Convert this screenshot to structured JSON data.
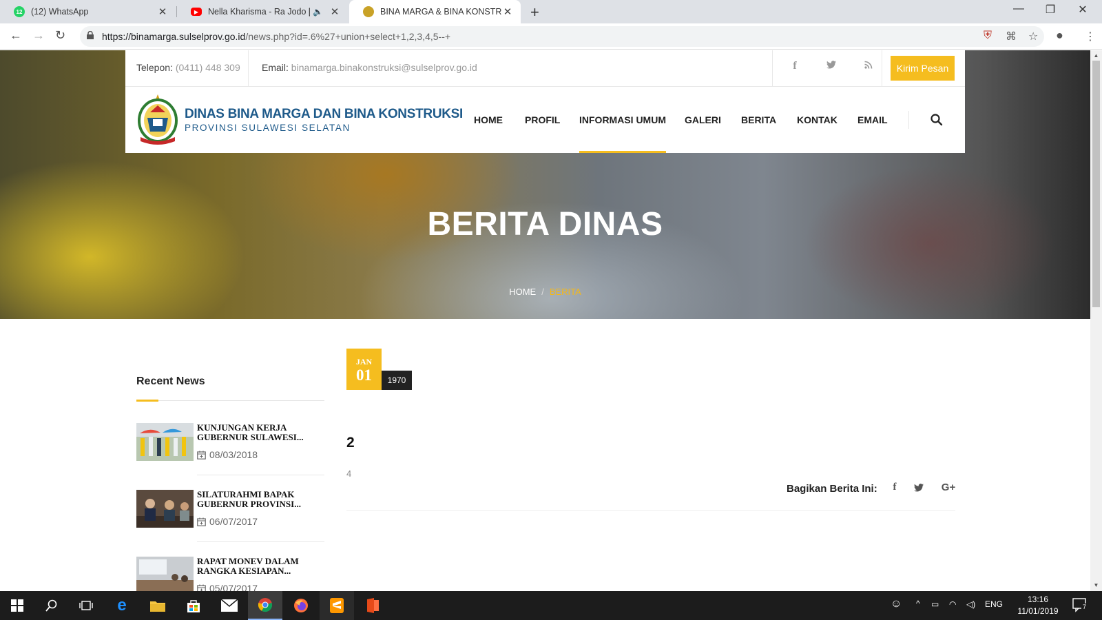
{
  "browser": {
    "tabs": [
      {
        "title": "(12) WhatsApp",
        "badge": "12"
      },
      {
        "title": "Nella Kharisma - Ra Jodo [Of"
      },
      {
        "title": "BINA MARGA & BINA KONSTRU"
      }
    ],
    "url_domain": "https://binamarga.sulselprov.go.id",
    "url_path": "/news.php?id=.6%27+union+select+1,2,3,4,5--+"
  },
  "topbar": {
    "phone_label": "Telepon:",
    "phone_value": "(0411) 448 309",
    "email_label": "Email:",
    "email_value": "binamarga.binakonstruksi@sulselprov.go.id",
    "cta_label": "Kirim Pesan"
  },
  "brand": {
    "line1": "DINAS BINA MARGA DAN BINA KONSTRUKSI",
    "line2": "PROVINSI SULAWESI SELATAN"
  },
  "nav": [
    "HOME",
    "PROFIL",
    "INFORMASI UMUM",
    "GALERI",
    "BERITA",
    "KONTAK",
    "EMAIL"
  ],
  "hero": {
    "title": "BERITA DINAS",
    "breadcrumb_home": "HOME",
    "breadcrumb_sep": "/",
    "breadcrumb_current": "BERITA"
  },
  "sidebar": {
    "title": "Recent News",
    "items": [
      {
        "title": "KUNJUNGAN KERJA GUBERNUR SULAWESI...",
        "date": "08/03/2018"
      },
      {
        "title": "SILATURAHMI BAPAK GUBERNUR PROVINSI...",
        "date": "06/07/2017"
      },
      {
        "title": "RAPAT MONEV DALAM RANGKA KESIAPAN...",
        "date": "05/07/2017"
      }
    ]
  },
  "article": {
    "month": "JAN",
    "day": "01",
    "year": "1970",
    "title": "2",
    "body": "4",
    "share_label": "Bagikan Berita Ini:"
  },
  "taskbar": {
    "lang": "ENG",
    "time": "13:16",
    "date": "11/01/2019",
    "notif_count": "7"
  },
  "colors": {
    "accent": "#f5bd1f",
    "brand_blue": "#1e5a8a"
  }
}
